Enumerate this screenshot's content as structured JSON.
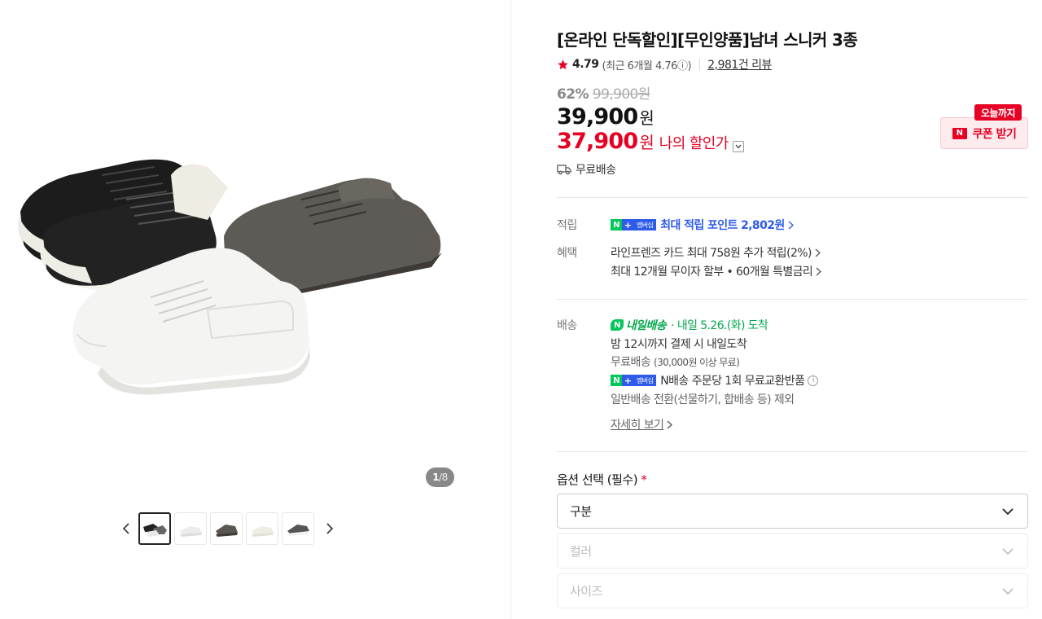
{
  "product": {
    "title": "[온라인 단독할인][무인양품]남녀 스니커 3종",
    "rating": "4.79",
    "rating_recent": "(최근 6개월 4.76ⓘ)",
    "review_count": "2,981건 리뷰",
    "discount_rate": "62%",
    "original_price": "99,900원",
    "price": "39,900",
    "price_unit": "원",
    "my_price": "37,900",
    "my_price_unit": "원",
    "my_price_label": "나의 할인가",
    "shipping_short": "무료배송"
  },
  "coupon": {
    "badge": "오늘까지",
    "label": "쿠폰 받기",
    "logo": "N"
  },
  "gallery": {
    "page_current": "1",
    "page_total": "/8",
    "thumbnails": [
      "thumb-1",
      "thumb-2",
      "thumb-3",
      "thumb-4",
      "thumb-5"
    ],
    "active_index": 0
  },
  "points": {
    "label": "적립",
    "badge_n": "N",
    "badge_plus": "+",
    "badge_mem": "멤버십",
    "text": "최대 적립 포인트 2,802원"
  },
  "benefits": {
    "label": "혜택",
    "lines": [
      "라인프렌즈 카드 최대 758원 추가 적립(2%)",
      "최대 12개월 무이자 할부 • 60개월 특별금리"
    ]
  },
  "delivery": {
    "label": "배송",
    "tomorrow_badge": "내일배송",
    "tomorrow_date": "· 내일 5.26.(화) 도착",
    "line1": "밤 12시까지 결제 시 내일도착",
    "line2_main": "무료배송",
    "line2_sub": "(30,000원 이상 무료)",
    "line3": "N배송 주문당 1회 무료교환반품",
    "line4": "일반배송 전환(선물하기, 합배송 등) 제외",
    "more": "자세히 보기"
  },
  "options": {
    "title": "옵션 선택 (필수)",
    "required_mark": "*",
    "selects": [
      {
        "label": "구분",
        "enabled": true
      },
      {
        "label": "컬러",
        "enabled": false
      },
      {
        "label": "사이즈",
        "enabled": false
      }
    ]
  },
  "colors": {
    "accent_red": "#e60023",
    "naver_green": "#03c75a",
    "membership_blue": "#2f5bea"
  }
}
